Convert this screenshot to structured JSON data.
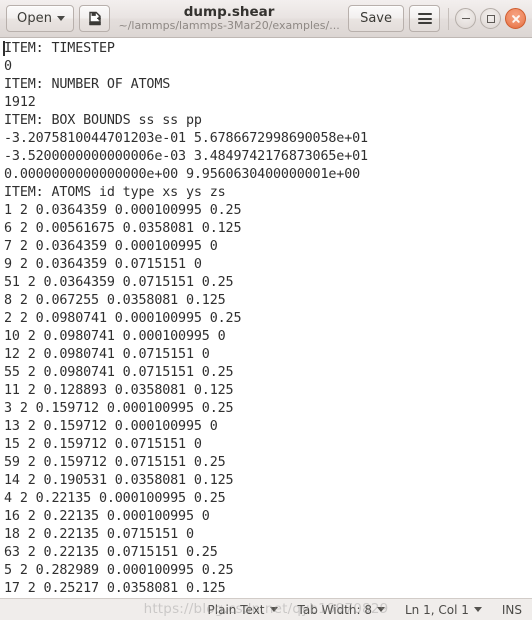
{
  "window": {
    "title": "dump.shear",
    "subtitle": "~/lammps/lammps-3Mar20/examples/..."
  },
  "headerbar": {
    "open_label": "Open",
    "save_label": "Save",
    "newdoc_icon": "new-document-icon",
    "menu_icon": "hamburger-menu-icon",
    "minimize_icon": "minimize-icon",
    "maximize_icon": "maximize-icon",
    "close_icon": "close-icon",
    "dropdown_icon": "chevron-down-icon"
  },
  "editor": {
    "lines": [
      "ITEM: TIMESTEP",
      "0",
      "ITEM: NUMBER OF ATOMS",
      "1912",
      "ITEM: BOX BOUNDS ss ss pp",
      "-3.2075810044701203e-01 5.6786672998690058e+01",
      "-3.5200000000000006e-03 3.4849742176873065e+01",
      "0.0000000000000000e+00 9.9560630400000001e+00",
      "ITEM: ATOMS id type xs ys zs",
      "1 2 0.0364359 0.000100995 0.25",
      "6 2 0.00561675 0.0358081 0.125",
      "7 2 0.0364359 0.000100995 0",
      "9 2 0.0364359 0.0715151 0",
      "51 2 0.0364359 0.0715151 0.25",
      "8 2 0.067255 0.0358081 0.125",
      "2 2 0.0980741 0.000100995 0.25",
      "10 2 0.0980741 0.000100995 0",
      "12 2 0.0980741 0.0715151 0",
      "55 2 0.0980741 0.0715151 0.25",
      "11 2 0.128893 0.0358081 0.125",
      "3 2 0.159712 0.000100995 0.25",
      "13 2 0.159712 0.000100995 0",
      "15 2 0.159712 0.0715151 0",
      "59 2 0.159712 0.0715151 0.25",
      "14 2 0.190531 0.0358081 0.125",
      "4 2 0.22135 0.000100995 0.25",
      "16 2 0.22135 0.000100995 0",
      "18 2 0.22135 0.0715151 0",
      "63 2 0.22135 0.0715151 0.25",
      "5 2 0.282989 0.000100995 0.25",
      "17 2 0.25217 0.0358081 0.125"
    ]
  },
  "statusbar": {
    "language": "Plain Text",
    "tab_width": "Tab Width: 8",
    "position": "Ln 1, Col 1",
    "insert_mode": "INS"
  },
  "overlay": {
    "watermark": "https://blog.csdn.net/qyb19970829"
  }
}
